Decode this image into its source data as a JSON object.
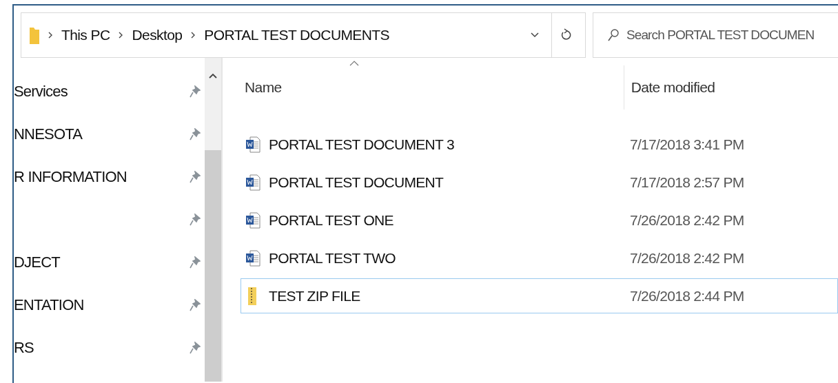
{
  "address_bar": {
    "breadcrumbs": [
      "This PC",
      "Desktop",
      "PORTAL TEST DOCUMENTS"
    ]
  },
  "search": {
    "placeholder": "Search PORTAL TEST DOCUMEN"
  },
  "sidebar": {
    "items": [
      {
        "label": "Services",
        "pinned": true
      },
      {
        "label": "NNESOTA",
        "pinned": true
      },
      {
        "label": "R INFORMATION",
        "pinned": true
      },
      {
        "pinned": true
      },
      {
        "label": "DJECT",
        "pinned": true
      },
      {
        "label": "ENTATION",
        "pinned": true
      },
      {
        "label": "RS",
        "pinned": true
      }
    ]
  },
  "table": {
    "columns": [
      "Name",
      "Date modified"
    ],
    "rows": [
      {
        "kind": "word",
        "name": "PORTAL TEST DOCUMENT 3",
        "date": "7/17/2018 3:41 PM",
        "selected": false
      },
      {
        "kind": "word",
        "name": "PORTAL TEST DOCUMENT",
        "date": "7/17/2018 2:57 PM",
        "selected": false
      },
      {
        "kind": "word",
        "name": "PORTAL TEST ONE",
        "date": "7/26/2018 2:42 PM",
        "selected": false
      },
      {
        "kind": "word",
        "name": "PORTAL TEST TWO",
        "date": "7/26/2018 2:42 PM",
        "selected": false
      },
      {
        "kind": "zip",
        "name": "TEST ZIP FILE",
        "date": "7/26/2018 2:44 PM",
        "selected": true
      }
    ]
  }
}
